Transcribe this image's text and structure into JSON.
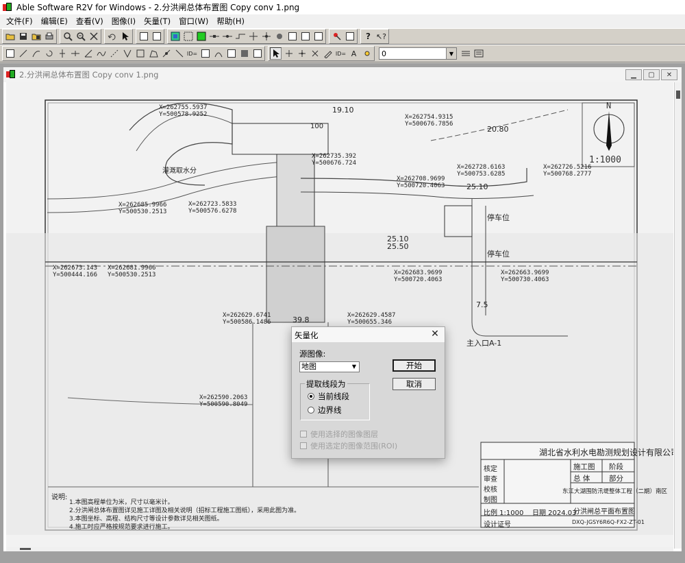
{
  "app": {
    "title": "Able Software R2V for Windows - 2.分洪闸总体布置图 Copy conv 1.png"
  },
  "menu": [
    "文件(F)",
    "编辑(E)",
    "查看(V)",
    "图像(I)",
    "矢量(T)",
    "窗口(W)",
    "帮助(H)"
  ],
  "toolbar": {
    "layer_value": "0"
  },
  "document": {
    "title": "2.分洪闸总体布置图 Copy conv 1.png",
    "scale": "1:1000",
    "north": "N"
  },
  "drawing_labels": {
    "c1": "X=262755.5937\nY=500578.9252",
    "c2": "X=262754.9315\nY=500676.7856",
    "c3": "X=262735.392\nY=500676.724",
    "c4": "X=262728.6163\nY=500753.6285",
    "c5": "X=262726.5216\nY=500768.2777",
    "c6": "X=262708.9699\nY=500720.4063",
    "c7": "X=262685.9966\nY=500530.2513",
    "c8": "X=262723.5833\nY=500576.6278",
    "c9": "X=262673.143\nY=500444.166",
    "c10": "X=262681.9966\nY=500530.2513",
    "c11": "X=262683.9699\nY=500720.4063",
    "c12": "X=262663.9699\nY=500730.4063",
    "c13": "X=262629.6741\nY=500586.1486",
    "c14": "X=262629.4587\nY=500655.346",
    "c15": "X=262590.2063\nY=500590.8049",
    "d1": "19.10",
    "d2": "20.80",
    "d3": "25.10",
    "d4": "25.50",
    "d5": "25.10",
    "d6": "39.8",
    "d7": "7.5",
    "d8": "100",
    "t1": "停车位",
    "t2": "停车位",
    "t3": "主入口A-1",
    "t4": "灌溉取水分",
    "notes_title": "说明:",
    "note1": "1.本图高程单位为米，尺寸以毫米计。",
    "note2": "2.分洪闸总体布置图详见施工详图及相关说明（招标工程施工图纸），采用此图为准。",
    "note3": "3.本图坐标、高程、结构尺寸等设计参数详见相关图纸。",
    "note4": "4.施工时应严格按规范要求进行施工。",
    "company": "湖北省水利水电勘测规划设计有限公司",
    "stage1": "施工图",
    "stage2": "阶段",
    "stage3": "总  体",
    "stage4": "部分",
    "project": "东江大湖围防汛堤整体工程（二期）南区",
    "drawing_title": "分洪闸总平面布置图",
    "scale_label": "比例 1:1000",
    "date_label": "日期  2024.03",
    "design_no": "设计证号",
    "drawing_no": "DXQ-JGSY6R6Q-FX2-ZT-01",
    "r_check": "核定",
    "r_review": "审查",
    "r_verify": "校核",
    "r_draw": "制图"
  },
  "dialog": {
    "title": "矢量化",
    "source_label": "源图像:",
    "source_value": "地图",
    "start": "开始",
    "cancel": "取消",
    "group_title": "提取线段为",
    "radio_current": "当前线段",
    "radio_boundary": "边界线",
    "use_selected_image": "使用选择的图像图层",
    "use_selected_roi": "使用选定的图像范围(ROI)"
  }
}
